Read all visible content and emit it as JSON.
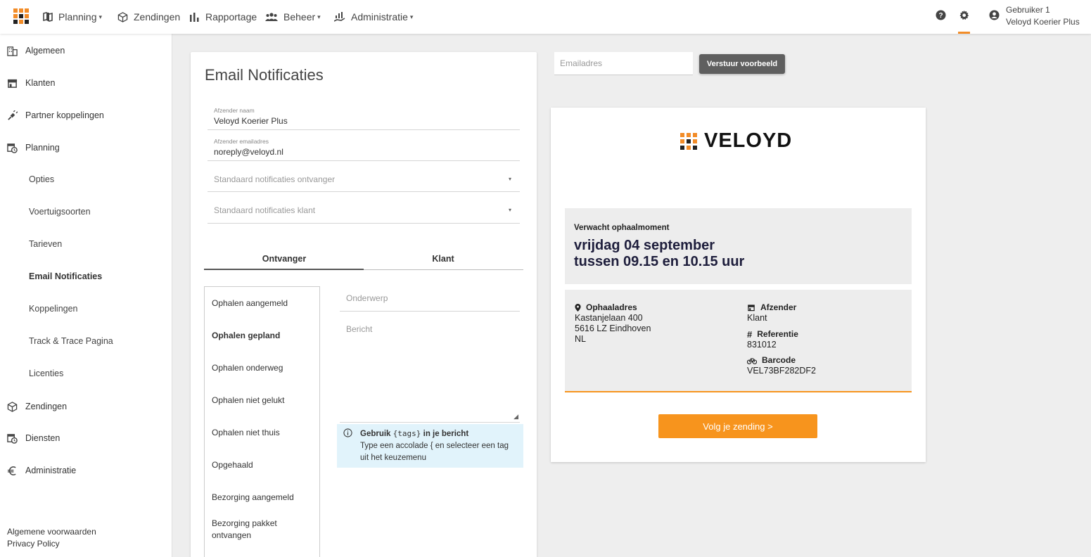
{
  "colors": {
    "accent": "#f28c28",
    "button_dark": "#5f5f5f",
    "cta": "#f7941d",
    "info_bg": "#e1f3fb"
  },
  "topnav": {
    "items": [
      {
        "label": "Planning",
        "icon": "map-icon",
        "has_dropdown": true
      },
      {
        "label": "Zendingen",
        "icon": "package-icon",
        "has_dropdown": false
      },
      {
        "label": "Rapportage",
        "icon": "bar-chart-icon",
        "has_dropdown": false
      },
      {
        "label": "Beheer",
        "icon": "people-icon",
        "has_dropdown": true
      },
      {
        "label": "Administratie",
        "icon": "chart-hand-icon",
        "has_dropdown": true
      }
    ],
    "user": {
      "name": "Gebruiker 1",
      "company": "Veloyd Koerier Plus"
    }
  },
  "sidebar": {
    "items": [
      {
        "label": "Algemeen",
        "icon": "building-icon"
      },
      {
        "label": "Klanten",
        "icon": "store-icon"
      },
      {
        "label": "Partner koppelingen",
        "icon": "plug-icon"
      },
      {
        "label": "Planning",
        "icon": "calendar-clock-icon"
      }
    ],
    "sub_items": [
      {
        "label": "Opties",
        "active": false
      },
      {
        "label": "Voertuigsoorten",
        "active": false
      },
      {
        "label": "Tarieven",
        "active": false
      },
      {
        "label": "Email Notificaties",
        "active": true
      },
      {
        "label": "Koppelingen",
        "active": false
      },
      {
        "label": "Track & Trace Pagina",
        "active": false
      },
      {
        "label": "Licenties",
        "active": false
      }
    ],
    "bottom_items": [
      {
        "label": "Zendingen",
        "icon": "package-icon"
      },
      {
        "label": "Diensten",
        "icon": "calendar-clock-icon"
      },
      {
        "label": "Administratie",
        "icon": "euro-icon"
      }
    ],
    "footer": {
      "terms": "Algemene voorwaarden",
      "privacy": "Privacy Policy"
    }
  },
  "form": {
    "title": "Email Notificaties",
    "sender_name": {
      "label": "Afzender naam",
      "value": "Veloyd Koerier Plus"
    },
    "sender_email": {
      "label": "Afzender emailadres",
      "value": "noreply@veloyd.nl"
    },
    "default_recipient": {
      "placeholder": "Standaard notificaties ontvanger"
    },
    "default_client": {
      "placeholder": "Standaard notificaties klant"
    },
    "tabs": [
      {
        "label": "Ontvanger",
        "active": true
      },
      {
        "label": "Klant",
        "active": false
      }
    ],
    "events": [
      {
        "label": "Ophalen aangemeld",
        "active": false
      },
      {
        "label": "Ophalen gepland",
        "active": true
      },
      {
        "label": "Ophalen onderweg",
        "active": false
      },
      {
        "label": "Ophalen niet gelukt",
        "active": false
      },
      {
        "label": "Ophalen niet thuis",
        "active": false
      },
      {
        "label": "Opgehaald",
        "active": false
      },
      {
        "label": "Bezorging aangemeld",
        "active": false
      },
      {
        "label": "Bezorging pakket ontvangen",
        "active": false
      }
    ],
    "subject_placeholder": "Onderwerp",
    "message_placeholder": "Bericht",
    "info": {
      "prefix": "Gebruik",
      "code": "{tags}",
      "suffix": "in je bericht",
      "line2": "Type een accolade { en selecteer een tag uit het keuzemenu"
    }
  },
  "preview": {
    "email_placeholder": "Emailadres",
    "send_button": "Verstuur voorbeeld",
    "brand": "VELOYD",
    "pickup_label": "Verwacht ophaalmoment",
    "pickup_day": "vrijdag 04 september",
    "pickup_time": "tussen 09.15 en 10.15 uur",
    "address_label": "Ophaaladres",
    "address_lines": [
      "Kastanjelaan 400",
      "5616 LZ Eindhoven",
      "NL"
    ],
    "sender_label": "Afzender",
    "sender_value": "Klant",
    "reference_label": "Referentie",
    "reference_value": "831012",
    "barcode_label": "Barcode",
    "barcode_value": "VEL73BF282DF2",
    "cta": "Volg je zending >"
  }
}
